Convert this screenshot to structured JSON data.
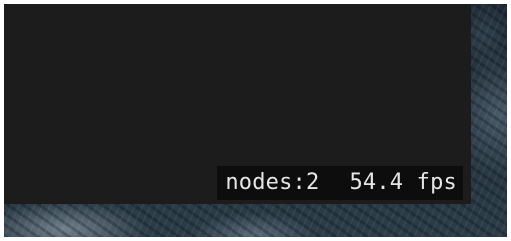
{
  "stats": {
    "nodes_label": "nodes:2",
    "fps_label": "54.4 fps"
  }
}
